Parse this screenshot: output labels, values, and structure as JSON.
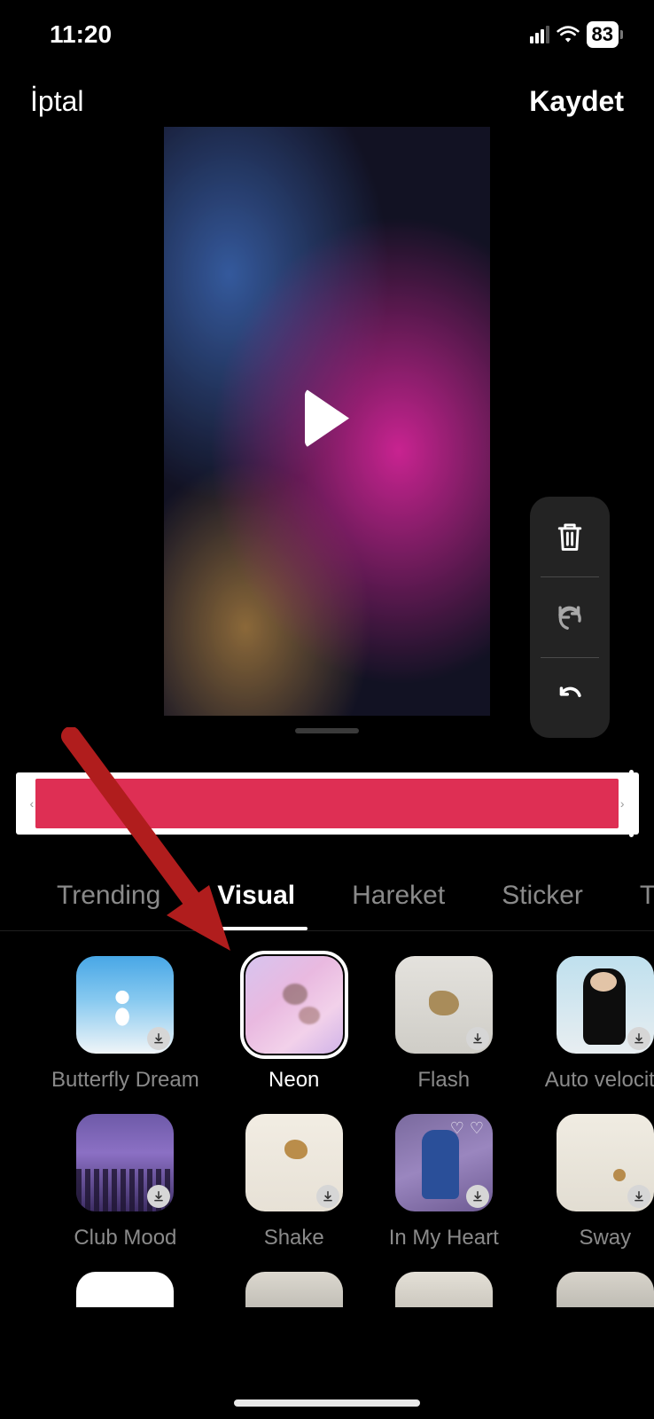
{
  "status": {
    "time": "11:20",
    "battery": "83"
  },
  "actions": {
    "cancel": "İptal",
    "save": "Kaydet"
  },
  "tabs": [
    "Trending",
    "Visual",
    "Hareket",
    "Sticker",
    "Tr"
  ],
  "active_tab_index": 1,
  "effects": [
    {
      "label": "Butterfly Dream",
      "downloadable": true,
      "selected": false,
      "thumb": "bg-butterfly"
    },
    {
      "label": "Neon",
      "downloadable": false,
      "selected": true,
      "thumb": "bg-neon"
    },
    {
      "label": "Flash",
      "downloadable": true,
      "selected": false,
      "thumb": "bg-flash"
    },
    {
      "label": "Auto velocity",
      "downloadable": true,
      "selected": false,
      "thumb": "bg-velocity"
    },
    {
      "label": "Club Mood",
      "downloadable": true,
      "selected": false,
      "thumb": "bg-club"
    },
    {
      "label": "Shake",
      "downloadable": true,
      "selected": false,
      "thumb": "bg-shake"
    },
    {
      "label": "In My Heart",
      "downloadable": true,
      "selected": false,
      "thumb": "bg-heart"
    },
    {
      "label": "Sway",
      "downloadable": true,
      "selected": false,
      "thumb": "bg-sway"
    }
  ],
  "partial_row": [
    "bg-white",
    "bg-cloud1",
    "bg-cloud2",
    "bg-cloud3"
  ]
}
